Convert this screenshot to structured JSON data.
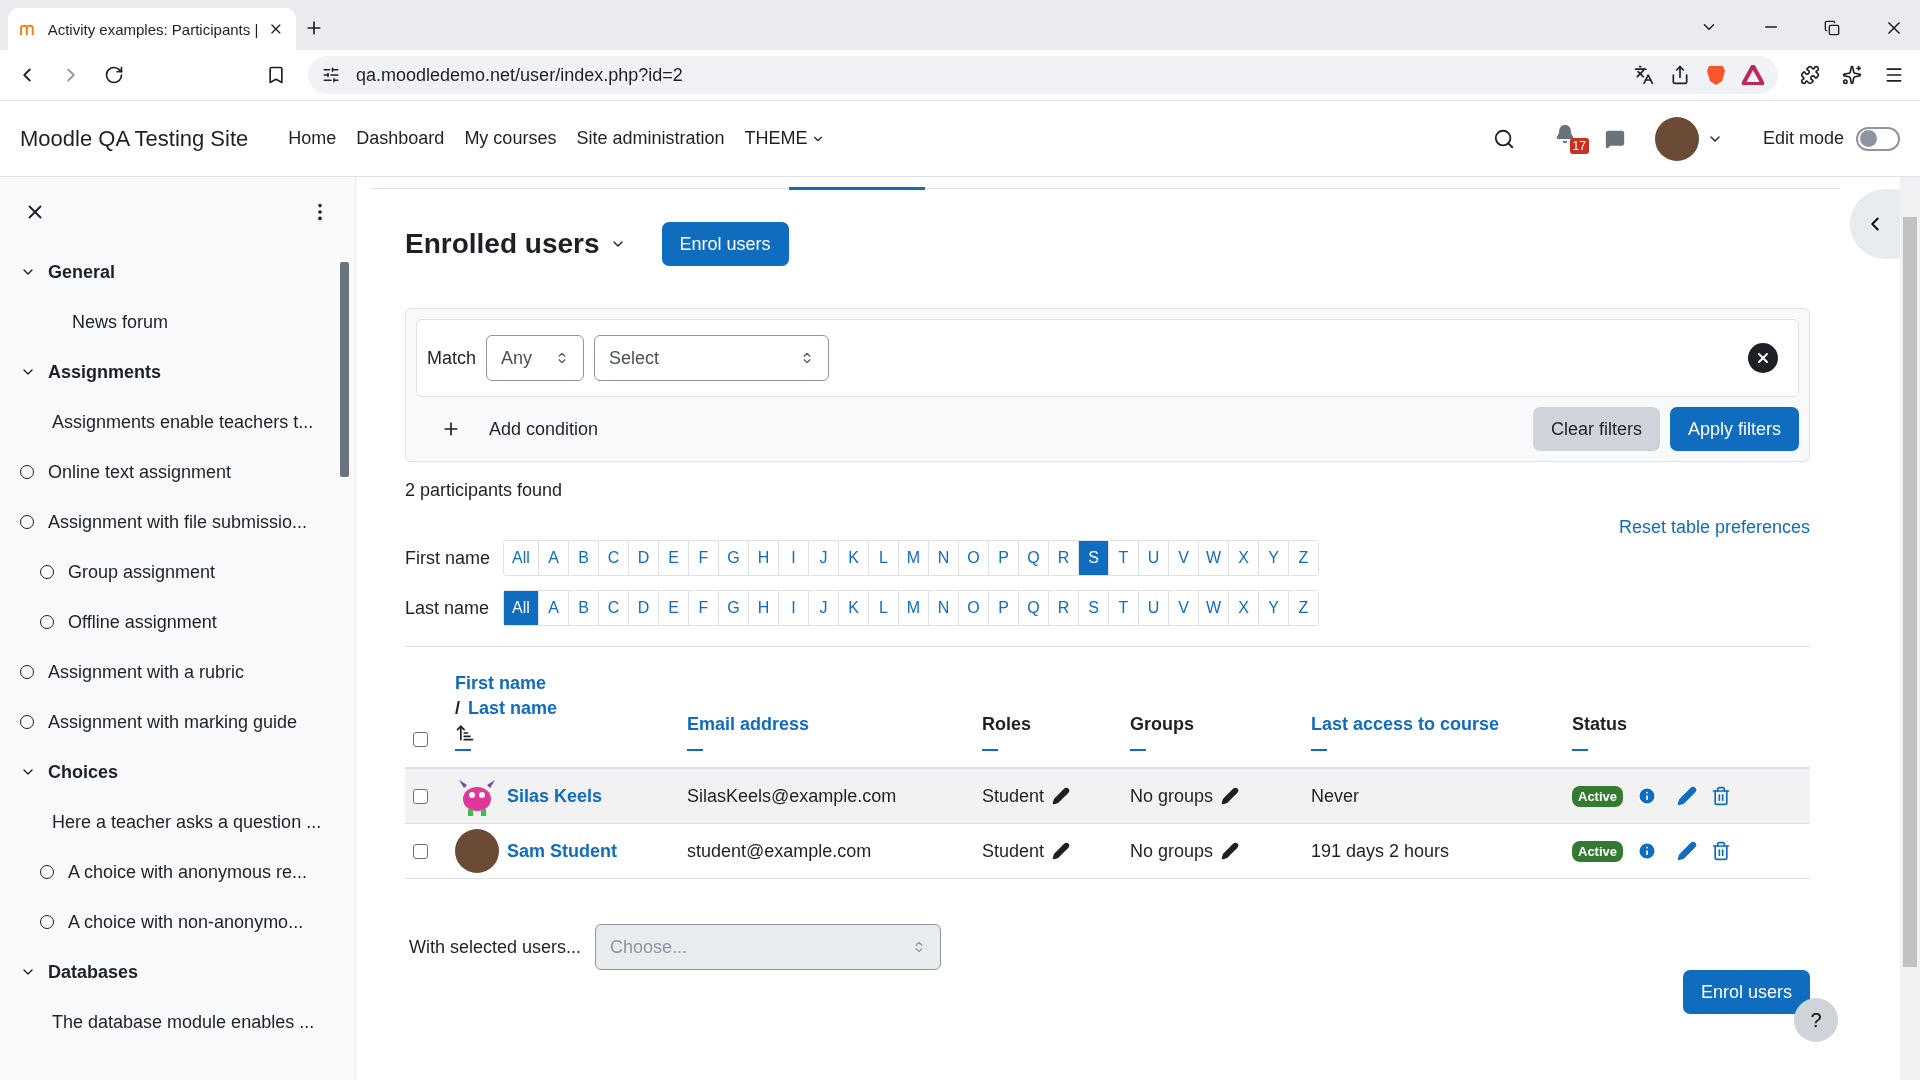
{
  "browser": {
    "tab_title": "Activity examples: Participants |",
    "url": "qa.moodledemo.net/user/index.php?id=2"
  },
  "navbar": {
    "site_name": "Moodle QA Testing Site",
    "links": [
      "Home",
      "Dashboard",
      "My courses",
      "Site administration"
    ],
    "menu": "THEME",
    "notification_count": "17",
    "edit_mode_label": "Edit mode",
    "edit_mode_on": false
  },
  "sidebar": {
    "sections": [
      {
        "title": "General",
        "expanded": true,
        "items": [
          {
            "label": "News forum",
            "indented": true,
            "completion": false
          }
        ]
      },
      {
        "title": "Assignments",
        "expanded": true,
        "items": [
          {
            "label": "Assignments enable teachers t...",
            "indented": false,
            "completion": false
          },
          {
            "label": "Online text assignment",
            "indented": false,
            "completion": true
          },
          {
            "label": "Assignment with file submissio...",
            "indented": false,
            "completion": true
          },
          {
            "label": "Group assignment",
            "indented": true,
            "completion": true
          },
          {
            "label": "Offline assignment",
            "indented": true,
            "completion": true
          },
          {
            "label": "Assignment with a rubric",
            "indented": false,
            "completion": true
          },
          {
            "label": "Assignment with marking guide",
            "indented": false,
            "completion": true
          }
        ]
      },
      {
        "title": "Choices",
        "expanded": true,
        "items": [
          {
            "label": "Here a teacher asks a question ...",
            "indented": false,
            "completion": false
          },
          {
            "label": "A choice with anonymous re...",
            "indented": true,
            "completion": true
          },
          {
            "label": "A choice with non-anonymo...",
            "indented": true,
            "completion": true
          }
        ]
      },
      {
        "title": "Databases",
        "expanded": true,
        "items": [
          {
            "label": "The database module enables ...",
            "indented": false,
            "completion": false
          }
        ]
      }
    ]
  },
  "heading": "Enrolled users",
  "enrol_button": "Enrol users",
  "filter": {
    "match_label": "Match",
    "match_value": "Any",
    "condition_placeholder": "Select",
    "add_condition": "Add condition",
    "clear_button": "Clear filters",
    "apply_button": "Apply filters"
  },
  "participants_found": "2 participants found",
  "reset_link": "Reset table preferences",
  "initials": [
    {
      "label": "First name",
      "letters": [
        {
          "label": "All",
          "selected": false
        },
        {
          "label": "A",
          "selected": false
        },
        {
          "label": "B",
          "selected": false
        },
        {
          "label": "C",
          "selected": false
        },
        {
          "label": "D",
          "selected": false
        },
        {
          "label": "E",
          "selected": false
        },
        {
          "label": "F",
          "selected": false
        },
        {
          "label": "G",
          "selected": false
        },
        {
          "label": "H",
          "selected": false
        },
        {
          "label": "I",
          "selected": false
        },
        {
          "label": "J",
          "selected": false
        },
        {
          "label": "K",
          "selected": false
        },
        {
          "label": "L",
          "selected": false
        },
        {
          "label": "M",
          "selected": false
        },
        {
          "label": "N",
          "selected": false
        },
        {
          "label": "O",
          "selected": false
        },
        {
          "label": "P",
          "selected": false
        },
        {
          "label": "Q",
          "selected": false
        },
        {
          "label": "R",
          "selected": false
        },
        {
          "label": "S",
          "selected": true
        },
        {
          "label": "T",
          "selected": false
        },
        {
          "label": "U",
          "selected": false
        },
        {
          "label": "V",
          "selected": false
        },
        {
          "label": "W",
          "selected": false
        },
        {
          "label": "X",
          "selected": false
        },
        {
          "label": "Y",
          "selected": false
        },
        {
          "label": "Z",
          "selected": false
        }
      ]
    },
    {
      "label": "Last name",
      "letters": [
        {
          "label": "All",
          "selected": true
        },
        {
          "label": "A",
          "selected": false
        },
        {
          "label": "B",
          "selected": false
        },
        {
          "label": "C",
          "selected": false
        },
        {
          "label": "D",
          "selected": false
        },
        {
          "label": "E",
          "selected": false
        },
        {
          "label": "F",
          "selected": false
        },
        {
          "label": "G",
          "selected": false
        },
        {
          "label": "H",
          "selected": false
        },
        {
          "label": "I",
          "selected": false
        },
        {
          "label": "J",
          "selected": false
        },
        {
          "label": "K",
          "selected": false
        },
        {
          "label": "L",
          "selected": false
        },
        {
          "label": "M",
          "selected": false
        },
        {
          "label": "N",
          "selected": false
        },
        {
          "label": "O",
          "selected": false
        },
        {
          "label": "P",
          "selected": false
        },
        {
          "label": "Q",
          "selected": false
        },
        {
          "label": "R",
          "selected": false
        },
        {
          "label": "S",
          "selected": false
        },
        {
          "label": "T",
          "selected": false
        },
        {
          "label": "U",
          "selected": false
        },
        {
          "label": "V",
          "selected": false
        },
        {
          "label": "W",
          "selected": false
        },
        {
          "label": "X",
          "selected": false
        },
        {
          "label": "Y",
          "selected": false
        },
        {
          "label": "Z",
          "selected": false
        }
      ]
    }
  ],
  "table": {
    "name_header": {
      "first": "First name",
      "separator": "/",
      "last": "Last name"
    },
    "columns": [
      {
        "label": "Email address",
        "sortable": true
      },
      {
        "label": "Roles",
        "sortable": false
      },
      {
        "label": "Groups",
        "sortable": false
      },
      {
        "label": "Last access to course",
        "sortable": true
      },
      {
        "label": "Status",
        "sortable": false
      }
    ],
    "select_all_checked": false,
    "rows": [
      {
        "checked": false,
        "kind": "cartoon",
        "name": "Silas Keels",
        "email": "SilasKeels@example.com",
        "role": "Student",
        "groups": "No groups",
        "last_access": "Never",
        "status": "Active",
        "highlighted": true
      },
      {
        "checked": false,
        "kind": "photo",
        "name": "Sam Student",
        "email": "student@example.com",
        "role": "Student",
        "groups": "No groups",
        "last_access": "191 days 2 hours",
        "status": "Active",
        "highlighted": false
      }
    ]
  },
  "bulk": {
    "label": "With selected users...",
    "placeholder": "Choose...",
    "disabled": true
  },
  "footer_button": "Enrol users",
  "help_button": "?"
}
